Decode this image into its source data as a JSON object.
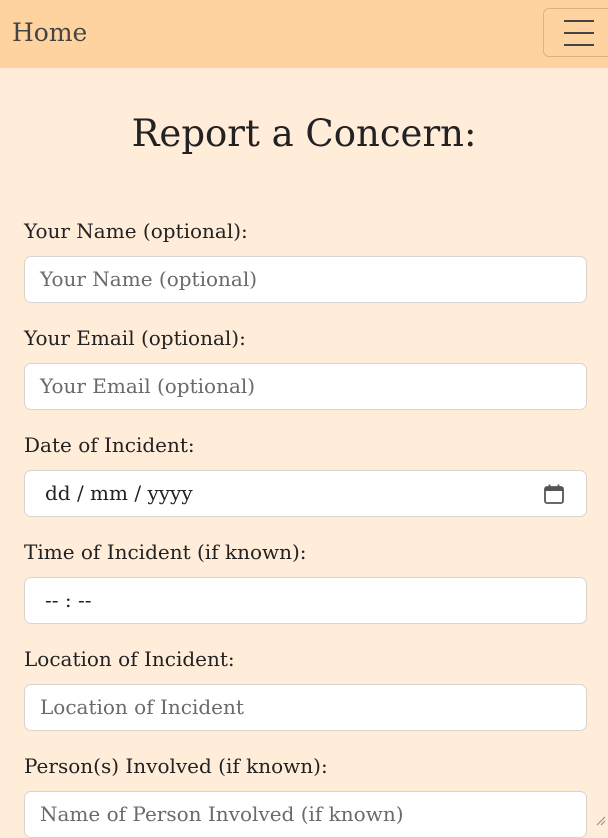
{
  "navbar": {
    "brand": "Home",
    "toggle_icon": "hamburger-menu-icon"
  },
  "form": {
    "title": "Report a Concern:",
    "name_label": "Your Name (optional):",
    "name_placeholder": "Your Name (optional)",
    "email_label": "Your Email (optional):",
    "email_placeholder": "Your Email (optional)",
    "date_label": "Date of Incident:",
    "date_value": "dd / mm / yyyy",
    "date_icon": "calendar-icon",
    "time_label": "Time of Incident (if known):",
    "time_value": "-- : --",
    "location_label": "Location of Incident:",
    "location_placeholder": "Location of Incident",
    "persons_label": "Person(s) Involved (if known):",
    "persons_placeholder": "Name of Person Involved (if known)"
  },
  "colors": {
    "background": "#ffecd9",
    "navbar": "#ffd39f",
    "input_background": "#ffffff",
    "text": "#222222",
    "placeholder": "#6a6a6a"
  }
}
